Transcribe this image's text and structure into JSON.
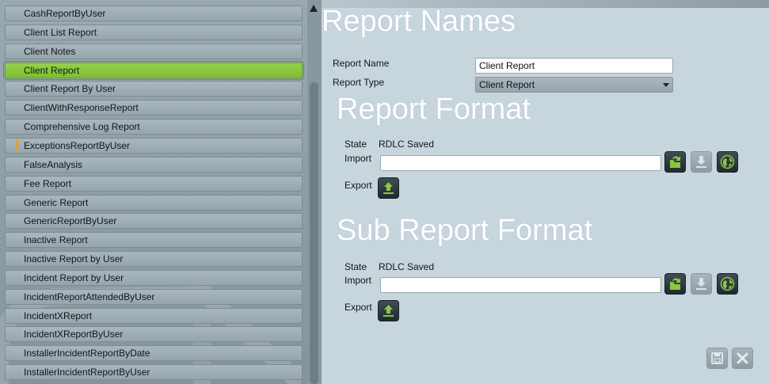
{
  "report_list": {
    "items": [
      {
        "label": "CashReportByUser",
        "selected": false,
        "warning": false
      },
      {
        "label": "Client List Report",
        "selected": false,
        "warning": false
      },
      {
        "label": "Client Notes",
        "selected": false,
        "warning": false
      },
      {
        "label": "Client Report",
        "selected": true,
        "warning": false
      },
      {
        "label": "Client Report By User",
        "selected": false,
        "warning": false
      },
      {
        "label": "ClientWithResponseReport",
        "selected": false,
        "warning": false
      },
      {
        "label": "Comprehensive Log Report",
        "selected": false,
        "warning": false
      },
      {
        "label": "ExceptionsReportByUser",
        "selected": false,
        "warning": true
      },
      {
        "label": "FalseAnalysis",
        "selected": false,
        "warning": false
      },
      {
        "label": "Fee Report",
        "selected": false,
        "warning": false
      },
      {
        "label": "Generic Report",
        "selected": false,
        "warning": false
      },
      {
        "label": "GenericReportByUser",
        "selected": false,
        "warning": false
      },
      {
        "label": "Inactive Report",
        "selected": false,
        "warning": false
      },
      {
        "label": "Inactive Report by User",
        "selected": false,
        "warning": false
      },
      {
        "label": "Incident Report by User",
        "selected": false,
        "warning": false
      },
      {
        "label": "IncidentReportAttendedByUser",
        "selected": false,
        "warning": false
      },
      {
        "label": "IncidentXReport",
        "selected": false,
        "warning": false
      },
      {
        "label": "IncidentXReportByUser",
        "selected": false,
        "warning": false
      },
      {
        "label": "InstallerIncidentReportByDate",
        "selected": false,
        "warning": false
      },
      {
        "label": "InstallerIncidentReportByUser",
        "selected": false,
        "warning": false
      }
    ]
  },
  "report_names": {
    "title": "Report Names",
    "name_label": "Report Name",
    "name_value": "Client Report",
    "type_label": "Report Type",
    "type_value": "Client Report"
  },
  "report_format": {
    "title": "Report Format",
    "state_label": "State",
    "state_value": "RDLC Saved",
    "import_label": "Import",
    "import_value": "",
    "export_label": "Export"
  },
  "sub_report_format": {
    "title": "Sub Report Format",
    "state_label": "State",
    "state_value": "RDLC Saved",
    "import_label": "Import",
    "import_value": "",
    "export_label": "Export"
  },
  "icons": {
    "open": "folder-open-icon",
    "download": "download-icon",
    "globe": "globe-icon",
    "upload": "upload-icon",
    "save": "save-icon",
    "cancel": "close-icon",
    "warning": "exclamation-icon",
    "scroll_up": "triangle-up-icon"
  },
  "colors": {
    "accent_green": "#8dc63f",
    "selected_item": "#88c840",
    "panel_bg": "#c7d5dd",
    "list_bg": "#8e9ca5",
    "warning_orange": "#f39c12",
    "title_white": "#ffffff"
  }
}
